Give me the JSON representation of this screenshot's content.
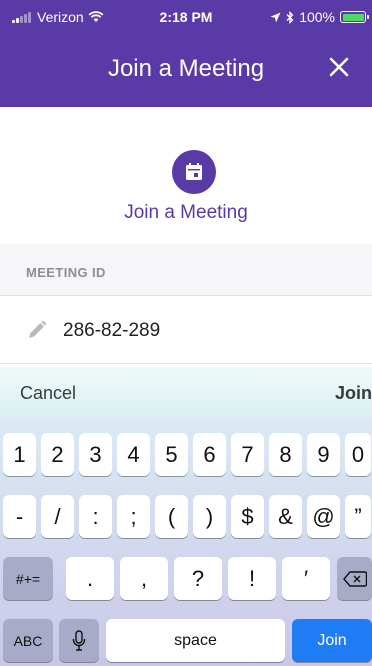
{
  "status_bar": {
    "carrier": "Verizon",
    "time": "2:18 PM",
    "battery": "100%",
    "battery_level": 1.0
  },
  "header": {
    "title": "Join a Meeting",
    "close_icon": "close-icon"
  },
  "hero": {
    "icon": "calendar-icon",
    "title": "Join a Meeting"
  },
  "meeting_id": {
    "label": "MEETING ID",
    "value": "286-82-289",
    "icon": "pencil-icon"
  },
  "accessory": {
    "cancel": "Cancel",
    "join": "Join"
  },
  "keyboard": {
    "row1": [
      "1",
      "2",
      "3",
      "4",
      "5",
      "6",
      "7",
      "8",
      "9",
      "0"
    ],
    "row2": [
      "-",
      "/",
      ":",
      ";",
      "(",
      ")",
      "$",
      "&",
      "@",
      "”"
    ],
    "row3_toggle": "#+=",
    "row3": [
      ".",
      ",",
      "?",
      "!",
      "′"
    ],
    "delete_icon": "backspace-icon",
    "abc": "ABC",
    "mic_icon": "microphone-icon",
    "space": "space",
    "join": "Join"
  },
  "colors": {
    "brand": "#5a3aa6",
    "join_key": "#1e7cf5",
    "battery": "#4cd964"
  }
}
